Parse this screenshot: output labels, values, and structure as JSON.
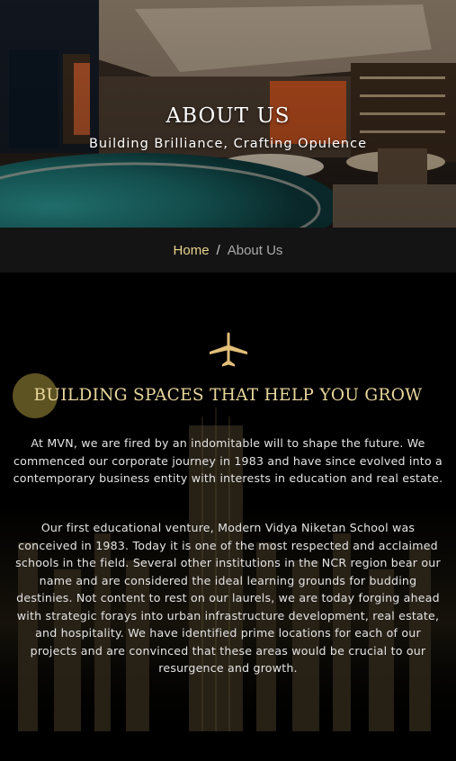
{
  "hero": {
    "title": "ABOUT US",
    "subtitle": "Building Brilliance, Crafting Opulence"
  },
  "breadcrumb": {
    "home": "Home",
    "separator": "/",
    "current": "About Us"
  },
  "section": {
    "icon": "airplane-icon",
    "heading": "BUILDING SPACES THAT HELP YOU GROW",
    "paragraphs": [
      "At MVN, we are fired by an indomitable will to shape the future. We commenced our corporate journey in 1983 and have since evolved into a contemporary business entity with interests in education and real estate.",
      "Our first educational venture, Modern Vidya Niketan School was conceived in 1983. Today it is one of the most respected and acclaimed schools in the field. Several other institutions in the NCR region bear our name and are considered the ideal learning grounds for budding destinies. Not content to rest on our laurels, we are today forging ahead with strategic forays into urban infrastructure development, real estate, and hospitality. We have identified prime locations for each of our projects and are convinced that these areas would be crucial to our resurgence and growth."
    ]
  },
  "colors": {
    "accent_gold": "#e8d69b",
    "breadcrumb_home": "#e7d38c",
    "breadcrumb_bar": "#141414",
    "page_background": "#000000"
  }
}
